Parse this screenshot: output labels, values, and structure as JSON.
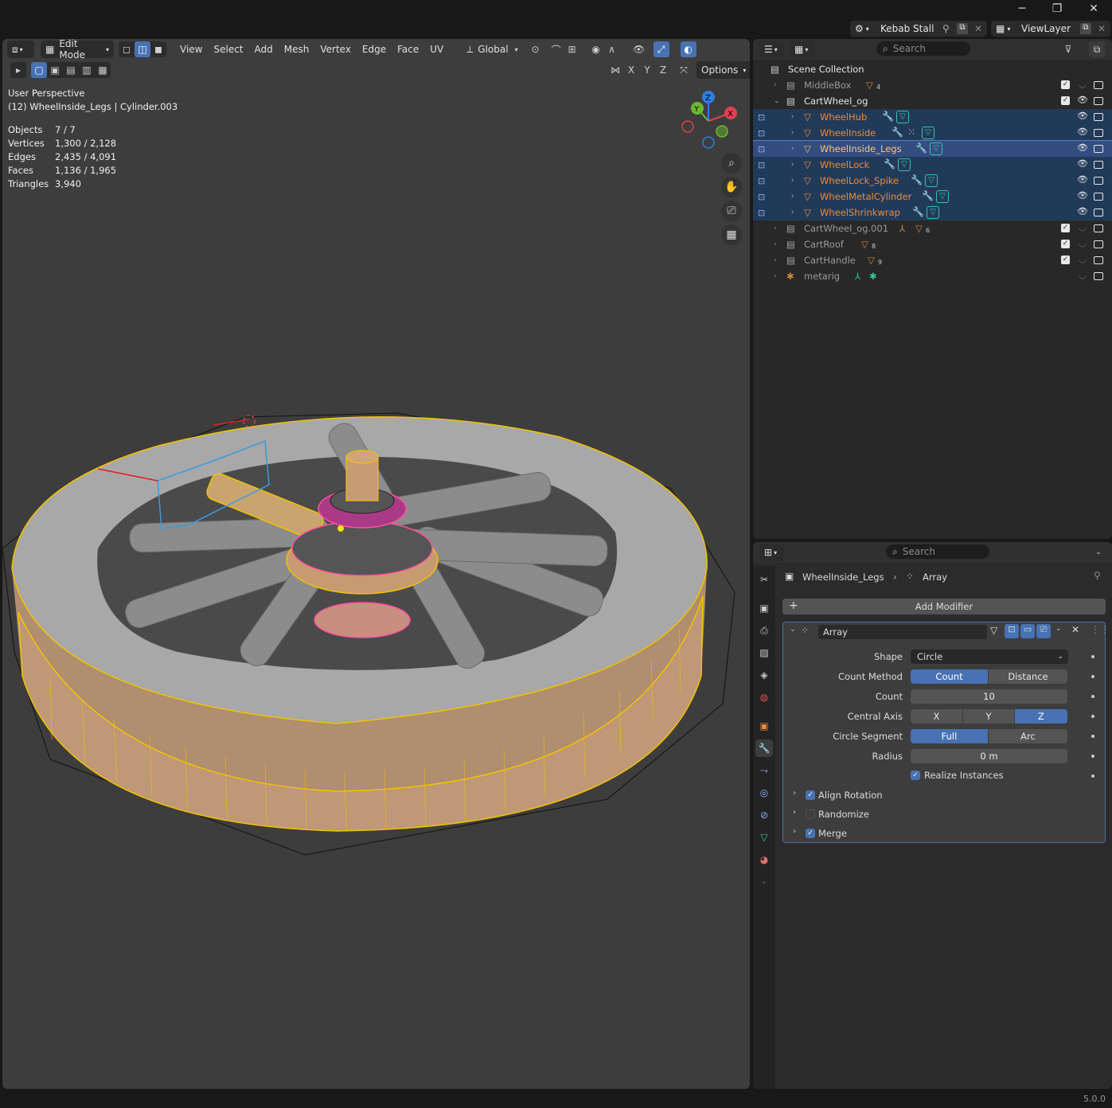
{
  "topbar": {
    "scene_name": "Kebab Stall",
    "view_layer": "ViewLayer",
    "minimize": "─",
    "maximize": "❐",
    "close": "✕"
  },
  "viewport_header": {
    "mode": "Edit Mode",
    "menus": [
      "View",
      "Select",
      "Add",
      "Mesh",
      "Vertex",
      "Edge",
      "Face",
      "UV"
    ],
    "transform_orientation": "Global",
    "axis_x": "X",
    "axis_y": "Y",
    "axis_z": "Z",
    "options": "Options"
  },
  "viewport": {
    "perspective": "User Perspective",
    "object_info": "(12) WheelInside_Legs | Cylinder.003",
    "stats": [
      {
        "label": "Objects",
        "value": "7 / 7"
      },
      {
        "label": "Vertices",
        "value": "1,300 / 2,128"
      },
      {
        "label": "Edges",
        "value": "2,435 / 4,091"
      },
      {
        "label": "Faces",
        "value": "1,136 / 1,965"
      },
      {
        "label": "Triangles",
        "value": "3,940"
      }
    ],
    "gizmo": {
      "x": "X",
      "y": "Y",
      "z": "Z"
    }
  },
  "outliner": {
    "search_placeholder": "Search",
    "scene_collection": "Scene Collection",
    "rows": [
      {
        "name": "MiddleBox",
        "sub": "4"
      },
      {
        "name": "CartWheel_og"
      },
      {
        "name": "WheelHub"
      },
      {
        "name": "WheelInside"
      },
      {
        "name": "WheelInside_Legs"
      },
      {
        "name": "WheelLock"
      },
      {
        "name": "WheelLock_Spike"
      },
      {
        "name": "WheelMetalCylinder"
      },
      {
        "name": "WheelShrinkwrap"
      },
      {
        "name": "CartWheel_og.001",
        "sub": "6"
      },
      {
        "name": "CartRoof",
        "sub": "8"
      },
      {
        "name": "CartHandle",
        "sub": "9"
      },
      {
        "name": "metarig"
      }
    ]
  },
  "properties": {
    "search_placeholder": "Search",
    "breadcrumb_object": "WheelInside_Legs",
    "breadcrumb_modifier": "Array",
    "add_modifier": "Add Modifier",
    "modifier_name": "Array",
    "shape_label": "Shape",
    "shape_value": "Circle",
    "count_method_label": "Count Method",
    "count_method_options": [
      "Count",
      "Distance"
    ],
    "count_label": "Count",
    "count_value": "10",
    "central_axis_label": "Central Axis",
    "central_axis_options": [
      "X",
      "Y",
      "Z"
    ],
    "circle_segment_label": "Circle Segment",
    "circle_segment_options": [
      "Full",
      "Arc"
    ],
    "radius_label": "Radius",
    "radius_value": "0 m",
    "realize_instances": "Realize Instances",
    "align_rotation": "Align Rotation",
    "randomize": "Randomize",
    "merge": "Merge"
  },
  "statusbar": {
    "version": "5.0.0"
  },
  "colors": {
    "accent": "#4772b3",
    "selected_object": "#ed8a3a",
    "data_icon": "#37c3a3"
  }
}
